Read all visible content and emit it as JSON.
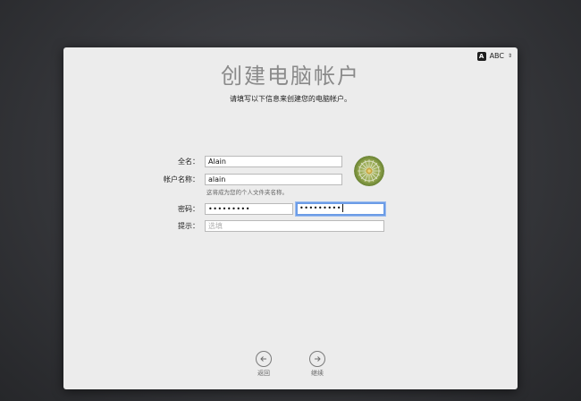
{
  "input_source": {
    "label": "ABC",
    "badge": "A"
  },
  "header": {
    "title": "创建电脑帐户",
    "subtitle": "请填写以下信息来创建您的电脑帐户。"
  },
  "form": {
    "full_name": {
      "label": "全名：",
      "value": "Alain"
    },
    "account_name": {
      "label": "帐户名称：",
      "value": "alain",
      "hint": "这将成为您的个人文件夹名称。"
    },
    "password": {
      "label": "密码：",
      "value": "•••••••••",
      "verify_value": "•••••••••"
    },
    "hint_field": {
      "label": "提示：",
      "placeholder": "选填"
    }
  },
  "avatar": {
    "icon": "dandelion-avatar-icon"
  },
  "nav": {
    "back_label": "返回",
    "continue_label": "继续"
  }
}
